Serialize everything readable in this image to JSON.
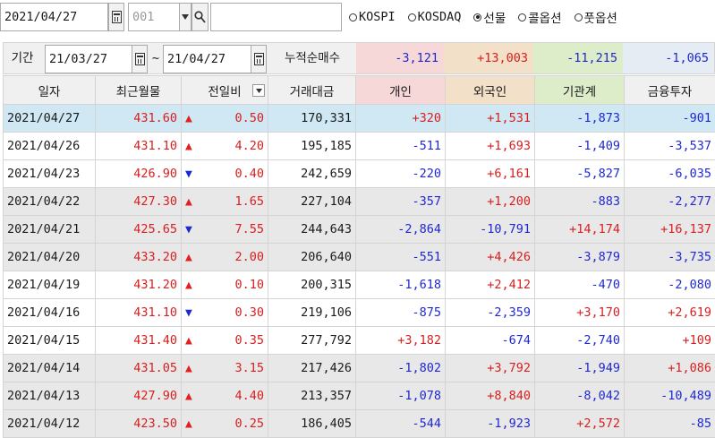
{
  "toolbar": {
    "date": "2021/04/27",
    "code": "001",
    "name_value": "",
    "markets": [
      {
        "label": "KOSPI",
        "selected": false
      },
      {
        "label": "KOSDAQ",
        "selected": false
      },
      {
        "label": "선물",
        "selected": true
      },
      {
        "label": "콜옵션",
        "selected": false
      },
      {
        "label": "풋옵션",
        "selected": false
      }
    ]
  },
  "period": {
    "label": "기간",
    "from": "21/03/27",
    "tilde": "~",
    "to": "21/04/27",
    "summary_label": "누적순매수",
    "summary": [
      {
        "value": "-3,121",
        "color": "#1f28d0",
        "bg": "#f6d8d8"
      },
      {
        "value": "+13,003",
        "color": "#d81e1e",
        "bg": "#f3e0c8"
      },
      {
        "value": "-11,215",
        "color": "#1f28d0",
        "bg": "#ddecc9"
      },
      {
        "value": "-1,065",
        "color": "#1f28d0",
        "bg": "#e6ecf4"
      }
    ]
  },
  "table": {
    "headers": [
      "일자",
      "최근월물",
      "전일비",
      "거래대금",
      "개인",
      "외국인",
      "기관계",
      "금융투자"
    ],
    "header_colors": [
      "#f0f0f0",
      "#f0f0f0",
      "#f0f0f0",
      "#f0f0f0",
      "#f6d8d8",
      "#f3e0c8",
      "#ddecc9",
      "#f0f0f0"
    ],
    "rows": [
      {
        "date": "2021/04/27",
        "price": "431.60",
        "dir": "up",
        "chg": "0.50",
        "amount": "170,331",
        "ind": "+320",
        "frn": "+1,531",
        "inst": "-1,873",
        "fin": "-901",
        "style": "sel"
      },
      {
        "date": "2021/04/26",
        "price": "431.10",
        "dir": "up",
        "chg": "4.20",
        "amount": "195,185",
        "ind": "-511",
        "frn": "+1,693",
        "inst": "-1,409",
        "fin": "-3,537",
        "style": ""
      },
      {
        "date": "2021/04/23",
        "price": "426.90",
        "dir": "down",
        "chg": "0.40",
        "amount": "242,659",
        "ind": "-220",
        "frn": "+6,161",
        "inst": "-5,827",
        "fin": "-6,035",
        "style": ""
      },
      {
        "date": "2021/04/22",
        "price": "427.30",
        "dir": "up",
        "chg": "1.65",
        "amount": "227,104",
        "ind": "-357",
        "frn": "+1,200",
        "inst": "-883",
        "fin": "-2,277",
        "style": "shade"
      },
      {
        "date": "2021/04/21",
        "price": "425.65",
        "dir": "down",
        "chg": "7.55",
        "amount": "244,643",
        "ind": "-2,864",
        "frn": "-10,791",
        "inst": "+14,174",
        "fin": "+16,137",
        "style": "shade"
      },
      {
        "date": "2021/04/20",
        "price": "433.20",
        "dir": "up",
        "chg": "2.00",
        "amount": "206,640",
        "ind": "-551",
        "frn": "+4,426",
        "inst": "-3,879",
        "fin": "-3,735",
        "style": "shade"
      },
      {
        "date": "2021/04/19",
        "price": "431.20",
        "dir": "up",
        "chg": "0.10",
        "amount": "200,315",
        "ind": "-1,618",
        "frn": "+2,412",
        "inst": "-470",
        "fin": "-2,080",
        "style": ""
      },
      {
        "date": "2021/04/16",
        "price": "431.10",
        "dir": "down",
        "chg": "0.30",
        "amount": "219,106",
        "ind": "-875",
        "frn": "-2,359",
        "inst": "+3,170",
        "fin": "+2,619",
        "style": ""
      },
      {
        "date": "2021/04/15",
        "price": "431.40",
        "dir": "up",
        "chg": "0.35",
        "amount": "277,792",
        "ind": "+3,182",
        "frn": "-674",
        "inst": "-2,740",
        "fin": "+109",
        "style": ""
      },
      {
        "date": "2021/04/14",
        "price": "431.05",
        "dir": "up",
        "chg": "3.15",
        "amount": "217,426",
        "ind": "-1,802",
        "frn": "+3,792",
        "inst": "-1,949",
        "fin": "+1,086",
        "style": "shade"
      },
      {
        "date": "2021/04/13",
        "price": "427.90",
        "dir": "up",
        "chg": "4.40",
        "amount": "213,357",
        "ind": "-1,078",
        "frn": "+8,840",
        "inst": "-8,042",
        "fin": "-10,489",
        "style": "shade"
      },
      {
        "date": "2021/04/12",
        "price": "423.50",
        "dir": "up",
        "chg": "0.25",
        "amount": "186,405",
        "ind": "-544",
        "frn": "-1,923",
        "inst": "+2,572",
        "fin": "-85",
        "style": "shade"
      }
    ]
  },
  "icons": {
    "up": "▲",
    "down": "▼",
    "calendar": "calendar-icon",
    "search": "search-icon",
    "dropdown": "chevron-down-icon"
  }
}
